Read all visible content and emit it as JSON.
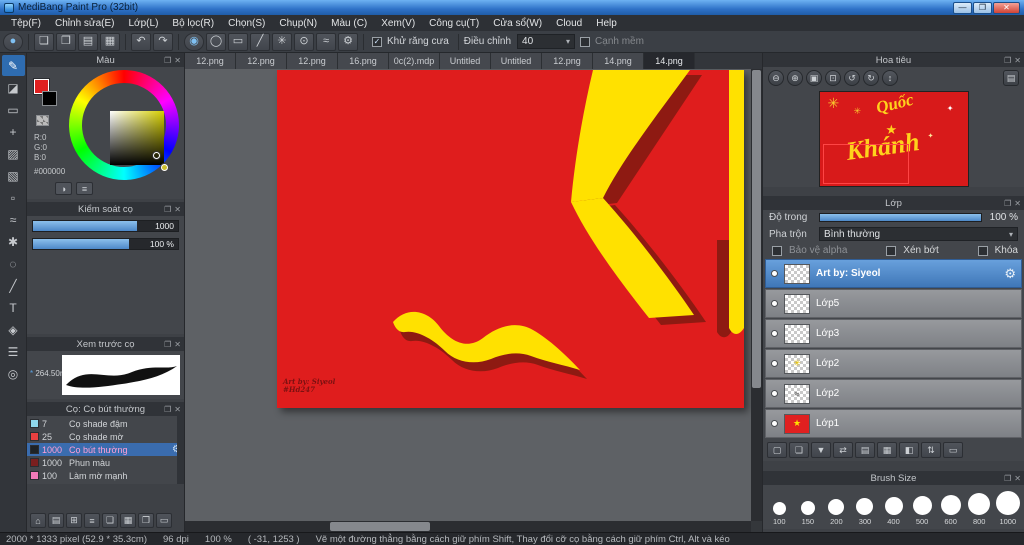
{
  "window": {
    "title": "MediBang Paint Pro (32bit)",
    "minimize": "—",
    "maximize": "❐",
    "close": "✕"
  },
  "chrome": {
    "pop": "❐",
    "close": "✕",
    "caret": "▾",
    "check": "✓"
  },
  "menu": {
    "items": [
      "Tệp(F)",
      "Chỉnh sửa(E)",
      "Lớp(L)",
      "Bộ lọc(R)",
      "Chọn(S)",
      "Chụp(N)",
      "Màu (C)",
      "Xem(V)",
      "Công cụ(T)",
      "Cửa sổ(W)",
      "Cloud",
      "Help"
    ]
  },
  "toolbar": {
    "glyphs": [
      "●",
      "❏",
      "❐",
      "▤",
      "▦",
      "↶",
      "↷",
      "◉",
      "◯",
      "▭",
      "╱",
      "✳",
      "⊙",
      "≈",
      "⚙"
    ],
    "antialias_label": "Khử răng cưa",
    "adjust_label": "Điều chỉnh",
    "adjust_value": "40",
    "soft_edge_label": "Cạnh mềm"
  },
  "tools": {
    "glyphs": [
      "✎",
      "◪",
      "▭",
      "+",
      "▨",
      "▧",
      "▫",
      "≈",
      "✱",
      "◌",
      "╱",
      "T",
      "◈",
      "☰",
      "◎"
    ]
  },
  "tabs": {
    "items": [
      "12.png",
      "12.png",
      "12.png",
      "16.png",
      "0c(2).mdp",
      "Untitled",
      "Untitled",
      "12.png",
      "14.png",
      "14.png"
    ]
  },
  "canvas": {
    "credit1": "Art by: Siyeol",
    "credit2": "#Hd247",
    "red": "#df1d1d",
    "yellow": "#ffe100",
    "shadow": "#8e1a12"
  },
  "panels": {
    "color": {
      "title": "Màu",
      "r": "R:0",
      "g": "G:0",
      "b": "B:0",
      "hex": "#000000",
      "icons": [
        "◑",
        "≡"
      ]
    },
    "brush_control": {
      "title": "Kiểm soát cọ",
      "size_value": "1000",
      "opacity_value": "100 %"
    },
    "preview": {
      "title": "Xem trước cọ",
      "star": "*",
      "size_label": "264.50m"
    },
    "brush_list": {
      "title": "Cọ: Cọ bút thường",
      "items": [
        {
          "value": "7",
          "name": "Cọ shade đậm",
          "chip": "#8fd8ec"
        },
        {
          "value": "25",
          "name": "Cọ shade mờ",
          "chip": "#e84040"
        },
        {
          "value": "1000",
          "name": "Cọ bút thường",
          "chip": "#1f2326"
        },
        {
          "value": "1000",
          "name": "Phun màu",
          "chip": "#7a1f1f"
        },
        {
          "value": "100",
          "name": "Làm mờ mạnh",
          "chip": "#f07ab8"
        }
      ]
    },
    "navigator": {
      "title": "Hoa tiêu",
      "glyphs": [
        "⊖",
        "⊕",
        "▣",
        "⊡",
        "↺",
        "↻",
        "↕",
        "▤"
      ],
      "art": {
        "word1": "Quốc",
        "word2": "Khánh",
        "star": "★",
        "spark": "✦",
        "burst": "✳"
      }
    },
    "layers": {
      "title": "Lớp",
      "opacity_label": "Độ trong",
      "opacity_value": "100 %",
      "blend_label": "Pha trộn",
      "blend_value": "Bình thường",
      "alpha_label": "Bảo vệ alpha",
      "clip_label": "Xén bớt",
      "lock_label": "Khóa",
      "gear": "⚙",
      "items": [
        {
          "name": "Art by: Siyeol"
        },
        {
          "name": "Lớp5"
        },
        {
          "name": "Lớp3"
        },
        {
          "name": "Lớp2"
        },
        {
          "name": "Lớp2"
        },
        {
          "name": "Lớp1"
        }
      ],
      "thumb_marks": [
        "",
        "",
        "",
        "✳",
        "≈",
        "★"
      ],
      "action_glyphs": [
        "▢",
        "❏",
        "▼",
        "⇄",
        "▤",
        "▦",
        "◧",
        "⇅",
        "▭"
      ]
    },
    "brush_size": {
      "title": "Brush Size",
      "sizes": [
        "100",
        "150",
        "200",
        "300",
        "400",
        "500",
        "600",
        "800",
        "1000"
      ]
    }
  },
  "left_icons": {
    "glyphs": [
      "⌂",
      "▤",
      "⊞",
      "≡",
      "❏",
      "▦",
      "❐",
      "▭"
    ]
  },
  "statusbar": {
    "dims": "2000 * 1333 pixel  (52.9 * 35.3cm)",
    "dpi": "96 dpi",
    "zoom": "100 %",
    "coords": "( -31, 1253 )",
    "hint": "Vẽ một đường thẳng bằng cách giữ phím Shift, Thay đổi cỡ cọ bằng cách giữ phím Ctrl, Alt và kéo"
  }
}
